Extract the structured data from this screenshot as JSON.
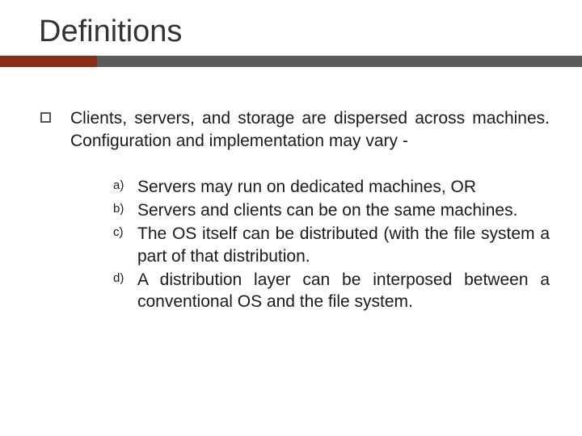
{
  "title": "Definitions",
  "main": "Clients, servers, and storage are dispersed across machines. Configuration and implementation may vary -",
  "items": [
    {
      "label": "a)",
      "text": "Servers may run on dedicated machines, OR"
    },
    {
      "label": "b)",
      "text": "Servers and clients can be on the same machines."
    },
    {
      "label": "c)",
      "text": "The OS itself can be distributed (with the file system a part of that distribution."
    },
    {
      "label": "d)",
      "text": "A distribution layer can be interposed between a conventional OS and the file system."
    }
  ]
}
